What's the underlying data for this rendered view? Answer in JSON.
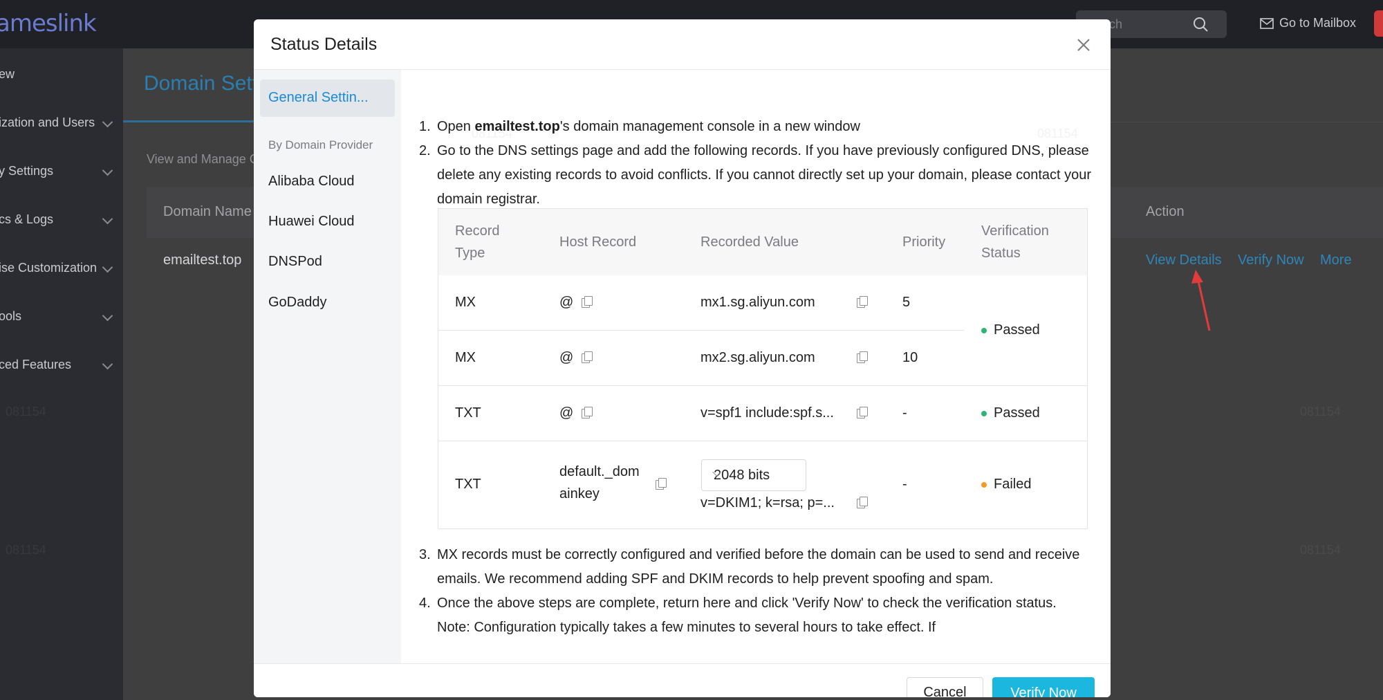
{
  "app": {
    "logo": "ameslink",
    "search_placeholder": "ch",
    "mailbox_label": "Go to Mailbox",
    "watermark": "081154"
  },
  "sidebar": {
    "items": [
      {
        "label": "ew",
        "chevron": false
      },
      {
        "label": "ization and Users",
        "chevron": true
      },
      {
        "label": "y Settings",
        "chevron": true
      },
      {
        "label": "cs & Logs",
        "chevron": true
      },
      {
        "label": "ise Customization",
        "chevron": true
      },
      {
        "label": "ools",
        "chevron": true
      },
      {
        "label": "ced Features",
        "chevron": true
      }
    ]
  },
  "page": {
    "title": "Domain Sett",
    "subtitle": "View and Manage C",
    "table": {
      "col_domain": "Domain Name",
      "col_action": "Action",
      "row_domain": "emailtest.top",
      "actions": [
        "View Details",
        "Verify Now",
        "More"
      ]
    }
  },
  "modal": {
    "title": "Status Details",
    "nav": {
      "active": "General Settin...",
      "group_label": "By Domain Provider",
      "providers": [
        "Alibaba Cloud",
        "Huawei Cloud",
        "DNSPod",
        "GoDaddy"
      ]
    },
    "steps": {
      "s1_num": "1.",
      "s1_pre": "Open ",
      "s1_bold": "emailtest.top",
      "s1_post": "'s domain management console in a new window",
      "s2_num": "2.",
      "s2": "Go to the DNS settings page and add the following records. If you have previously configured DNS, please delete any existing records to avoid conflicts. If you cannot directly set up your domain, please contact your domain registrar.",
      "s3_num": "3.",
      "s3": "MX records must be correctly configured and verified before the domain can be used to send and receive emails. We recommend adding SPF and DKIM records to help prevent spoofing and spam.",
      "s4_num": "4.",
      "s4": "Once the above steps are complete, return here and click 'Verify Now' to check the verification status. Note: Configuration typically takes a few minutes to several hours to take effect. If"
    },
    "records": {
      "headers": {
        "type": "Record Type",
        "host": "Host Record",
        "value": "Recorded Value",
        "priority": "Priority",
        "status": "Verification Status"
      },
      "rows": [
        {
          "type": "MX",
          "host": "@",
          "value": "mx1.sg.aliyun.com",
          "priority": "5"
        },
        {
          "type": "MX",
          "host": "@",
          "value": "mx2.sg.aliyun.com",
          "priority": "10"
        },
        {
          "type": "TXT",
          "host": "@",
          "value": "v=spf1 include:spf.s...",
          "priority": "-",
          "status": "Passed"
        },
        {
          "type": "TXT",
          "host": "default._dom ainkey",
          "value": "v=DKIM1; k=rsa; p=...",
          "priority": "-",
          "status": "Failed",
          "key_size": "2048 bits"
        }
      ],
      "mx_status": "Passed"
    },
    "cancel_label": "Cancel",
    "verify_label": "Verify Now"
  },
  "colors": {
    "accent": "#1cb7de",
    "link": "#1a8ad4",
    "passed": "#2bb673",
    "failed": "#f59a23"
  }
}
